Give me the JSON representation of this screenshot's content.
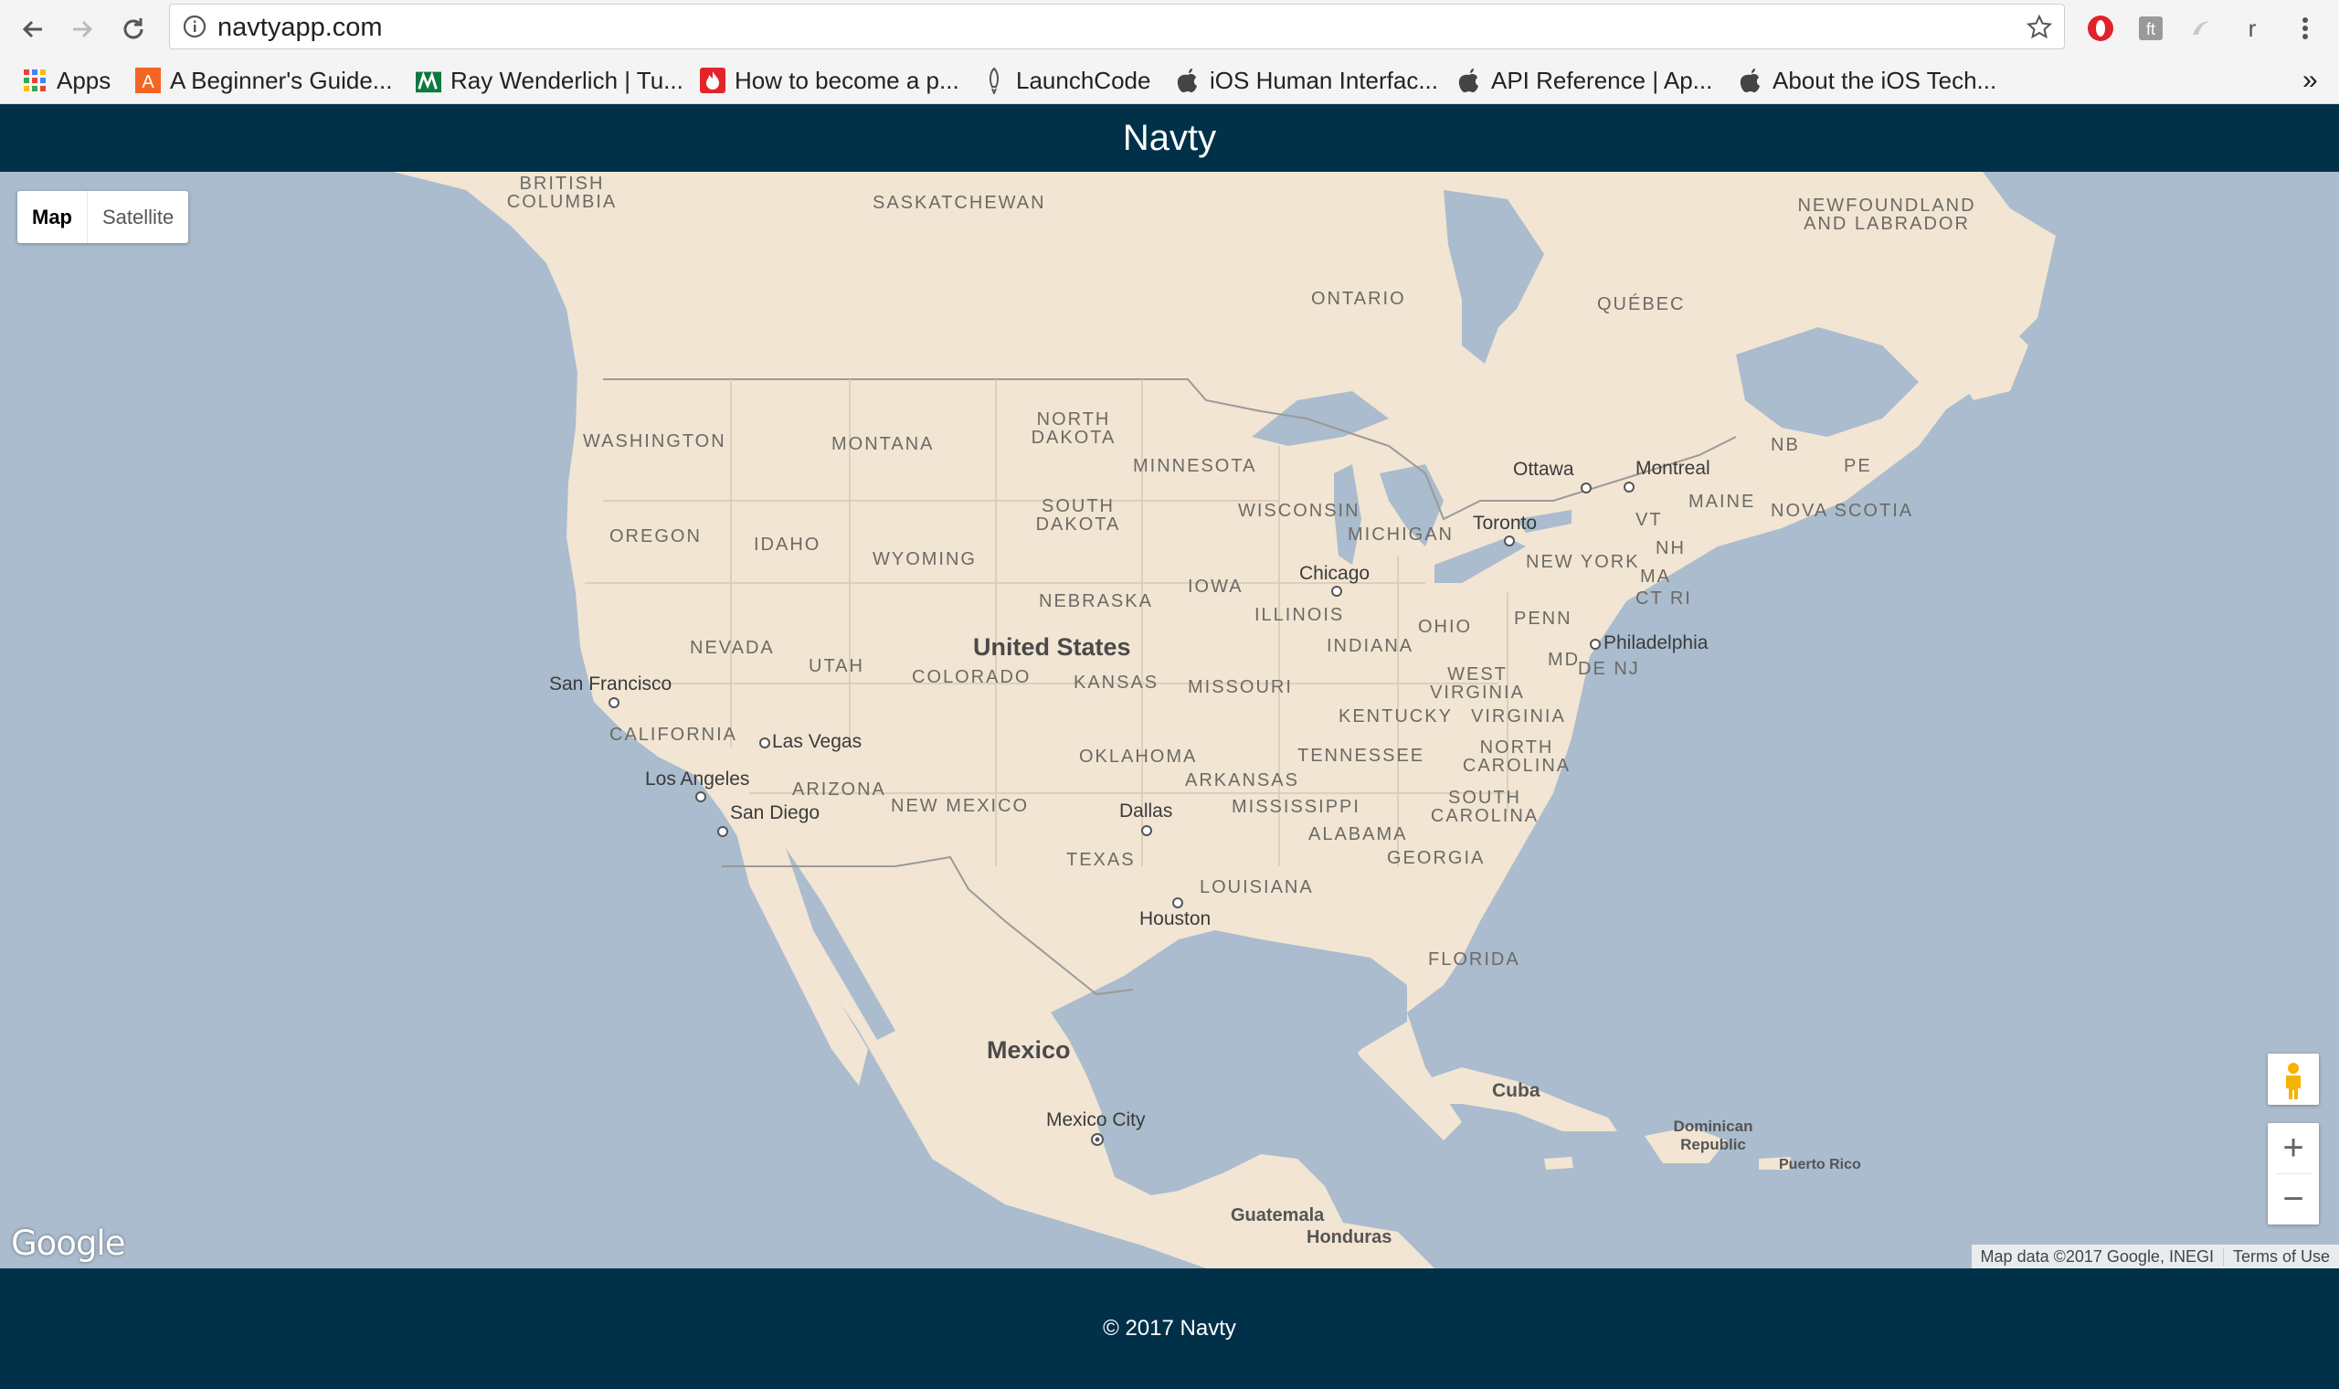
{
  "browser": {
    "url": "navtyapp.com",
    "bookmarks": [
      {
        "label": "Apps",
        "icon": "apps-grid-icon"
      },
      {
        "label": "A Beginner's Guide...",
        "icon": "orange-a-icon"
      },
      {
        "label": "Ray Wenderlich | Tu...",
        "icon": "rw-icon"
      },
      {
        "label": "How to become a p...",
        "icon": "flame-icon"
      },
      {
        "label": "LaunchCode",
        "icon": "rocket-icon"
      },
      {
        "label": "iOS Human Interfac...",
        "icon": "apple-icon"
      },
      {
        "label": "API Reference | Ap...",
        "icon": "apple-icon"
      },
      {
        "label": "About the iOS Tech...",
        "icon": "apple-icon"
      }
    ],
    "overflow_label": "»",
    "profile_initial": "r"
  },
  "site": {
    "title": "Navty",
    "footer": "© 2017 Navty"
  },
  "map": {
    "map_type_options": [
      "Map",
      "Satellite"
    ],
    "selected_map_type": "Map",
    "zoom_in": "+",
    "zoom_out": "−",
    "logo": "Google",
    "attribution": "Map data ©2017 Google, INEGI",
    "terms": "Terms of Use",
    "labels": {
      "british_columbia": "BRITISH COLUMBIA",
      "saskatchewan": "SASKATCHEWAN",
      "newfoundland": "NEWFOUNDLAND AND LABRADOR",
      "ontario": "ONTARIO",
      "quebec": "QUÉBEC",
      "washington": "WASHINGTON",
      "montana": "MONTANA",
      "north_dakota": "NORTH DAKOTA",
      "minnesota": "MINNESOTA",
      "oregon": "OREGON",
      "idaho": "IDAHO",
      "wyoming": "WYOMING",
      "south_dakota": "SOUTH DAKOTA",
      "wisconsin": "WISCONSIN",
      "michigan": "MICHIGAN",
      "nebraska": "NEBRASKA",
      "iowa": "IOWA",
      "illinois": "ILLINOIS",
      "indiana": "INDIANA",
      "ohio": "OHIO",
      "penn": "PENN",
      "nevada": "NEVADA",
      "utah": "UTAH",
      "colorado": "COLORADO",
      "kansas": "KANSAS",
      "missouri": "MISSOURI",
      "kentucky": "KENTUCKY",
      "west_virginia": "WEST VIRGINIA",
      "virginia": "VIRGINIA",
      "california": "CALIFORNIA",
      "arizona": "ARIZONA",
      "new_mexico": "NEW MEXICO",
      "oklahoma": "OKLAHOMA",
      "arkansas": "ARKANSAS",
      "tennessee": "TENNESSEE",
      "north_carolina": "NORTH CAROLINA",
      "south_carolina": "SOUTH CAROLINA",
      "mississippi": "MISSISSIPPI",
      "alabama": "ALABAMA",
      "georgia": "GEORGIA",
      "texas": "TEXAS",
      "louisiana": "LOUISIANA",
      "florida": "FLORIDA",
      "new_york": "NEW YORK",
      "maine": "MAINE",
      "vt": "VT",
      "nh": "NH",
      "ma": "MA",
      "ct_ri": "CT RI",
      "md": "MD",
      "de_nj": "DE NJ",
      "nb": "NB",
      "pe": "PE",
      "nova_scotia": "NOVA SCOTIA",
      "united_states": "United States",
      "mexico": "Mexico",
      "cuba": "Cuba",
      "dominican_republic": "Dominican Republic",
      "puerto_rico": "Puerto Rico",
      "guatemala": "Guatemala",
      "honduras": "Honduras",
      "ottawa": "Ottawa",
      "montreal": "Montreal",
      "toronto": "Toronto",
      "chicago": "Chicago",
      "philadelphia": "Philadelphia",
      "san_francisco": "San Francisco",
      "las_vegas": "Las Vegas",
      "los_angeles": "Los Angeles",
      "san_diego": "San Diego",
      "dallas": "Dallas",
      "houston": "Houston",
      "mexico_city": "Mexico City"
    }
  },
  "colors": {
    "header_bg": "#003149",
    "water": "#aabccd",
    "land": "#f2e5d3",
    "border": "#9a9a9a"
  }
}
